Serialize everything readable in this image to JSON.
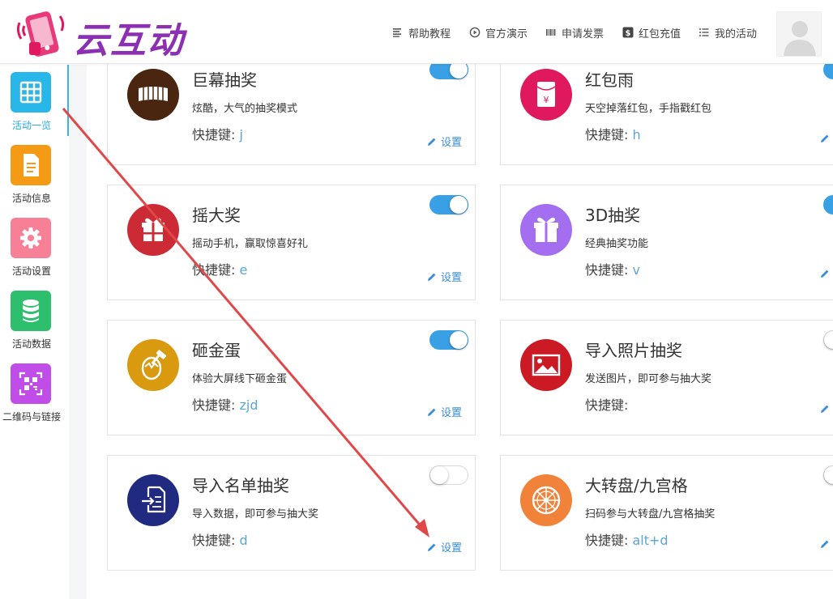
{
  "app": {
    "logo_text": "云互动"
  },
  "nav": [
    {
      "label": "帮助教程",
      "icon": "list-icon"
    },
    {
      "label": "官方演示",
      "icon": "play-circle-icon"
    },
    {
      "label": "申请发票",
      "icon": "barcode-icon"
    },
    {
      "label": "红包充值",
      "icon": "dollar-icon"
    },
    {
      "label": "我的活动",
      "icon": "bullet-list-icon"
    }
  ],
  "sidebar": {
    "items": [
      {
        "label": "活动一览",
        "icon": "grid-icon",
        "color": "#29b6e8",
        "active": true
      },
      {
        "label": "活动信息",
        "icon": "document-icon",
        "color": "#f59a14"
      },
      {
        "label": "活动设置",
        "icon": "gear-icon",
        "color": "#f77f96"
      },
      {
        "label": "活动数据",
        "icon": "database-icon",
        "color": "#2dbf6e"
      },
      {
        "label": "二维码与链接",
        "icon": "qrcode-icon",
        "color": "#c04de8"
      }
    ]
  },
  "hotkey_label": "快捷键:",
  "settings_label": "设置",
  "cards": [
    {
      "title": "巨幕抽奖",
      "desc": "炫酷，大气的抽奖模式",
      "hotkey": "j",
      "enabled": true,
      "icon": "screen-icon",
      "color": "#4a2510"
    },
    {
      "title": "红包雨",
      "desc": "天空掉落红包，手指戳红包",
      "hotkey": "h",
      "enabled": true,
      "icon": "red-envelope-icon",
      "color": "#e0195f"
    },
    {
      "title": "摇大奖",
      "desc": "摇动手机，赢取惊喜好礼",
      "hotkey": "e",
      "enabled": true,
      "icon": "gift-icon",
      "color": "#cc2b35"
    },
    {
      "title": "3D抽奖",
      "desc": "经典抽奖功能",
      "hotkey": "v",
      "enabled": true,
      "icon": "gift-box-icon",
      "color": "#a46ef0"
    },
    {
      "title": "砸金蛋",
      "desc": "体验大屏线下砸金蛋",
      "hotkey": "zjd",
      "enabled": true,
      "icon": "egg-hammer-icon",
      "color": "#d99a10"
    },
    {
      "title": "导入照片抽奖",
      "desc": "发送图片，即可参与抽大奖",
      "hotkey": "",
      "enabled": false,
      "icon": "photo-icon",
      "color": "#cc1a24"
    },
    {
      "title": "导入名单抽奖",
      "desc": "导入数据，即可参与抽大奖",
      "hotkey": "d",
      "enabled": false,
      "icon": "import-list-icon",
      "color": "#1f2a80"
    },
    {
      "title": "大转盘/九宫格",
      "desc": "扫码参与大转盘/九宫格抽奖",
      "hotkey": "alt+d",
      "enabled": false,
      "icon": "wheel-icon",
      "color": "#f0823a"
    }
  ],
  "annotation_color": "#e0484a"
}
